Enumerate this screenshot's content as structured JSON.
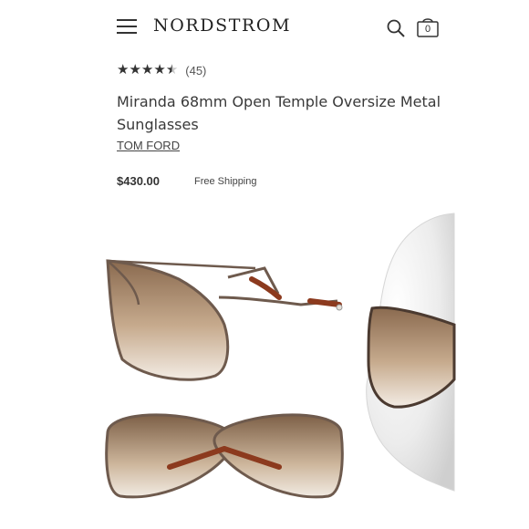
{
  "header": {
    "logo": "NORDSTROM",
    "menu_icon": "hamburger-menu-icon",
    "search_icon": "search-icon",
    "bag_icon": "shopping-bag-icon",
    "bag_count": "0"
  },
  "product": {
    "rating": 4.5,
    "review_count": "(45)",
    "title": "Miranda 68mm Open Temple Oversize Metal Sunglasses",
    "brand": "TOM FORD",
    "price": "$430.00",
    "shipping": "Free Shipping"
  },
  "colors": {
    "lens_top": "#8a6a4f",
    "lens_bottom": "#f3ece4",
    "frame": "#6e5a4d",
    "tortoise": "#8c3a1e"
  }
}
